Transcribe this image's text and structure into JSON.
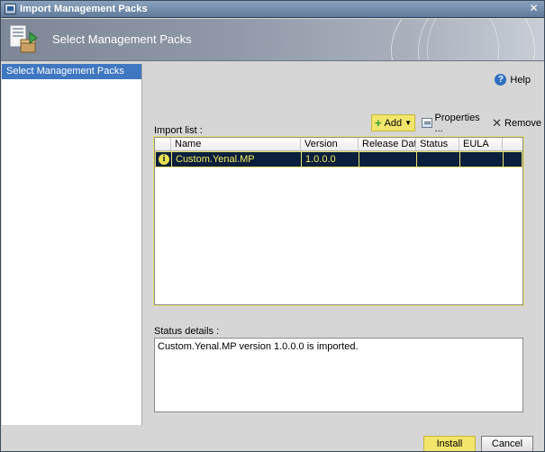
{
  "window": {
    "title": "Import Management Packs"
  },
  "banner": {
    "heading": "Select Management Packs"
  },
  "sidebar": {
    "items": [
      {
        "label": "Select Management Packs",
        "selected": true
      }
    ]
  },
  "help": {
    "label": "Help"
  },
  "import_list": {
    "label": "Import list :",
    "toolbar": {
      "add": "Add",
      "properties": "Properties ...",
      "remove": "Remove"
    },
    "columns": [
      "Name",
      "Version",
      "Release Date",
      "Status",
      "EULA"
    ],
    "rows": [
      {
        "name": "Custom.Yenal.MP",
        "version": "1.0.0.0",
        "release_date": "",
        "status": "",
        "eula": ""
      }
    ]
  },
  "status_details": {
    "label": "Status details :",
    "text": "Custom.Yenal.MP version 1.0.0.0 is imported."
  },
  "buttons": {
    "install": "Install",
    "cancel": "Cancel"
  },
  "colors": {
    "highlight": "#f2e56b",
    "selected_row_bg": "#0a1f3d",
    "selected_row_text": "#f4ea5c",
    "sidebar_selected": "#3f77c1"
  }
}
